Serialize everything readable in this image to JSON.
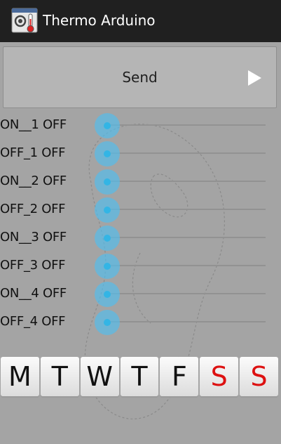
{
  "app": {
    "title": "Thermo Arduino",
    "icon": "thermometer-window-icon"
  },
  "send_button": {
    "label": "Send",
    "icon": "play-arrow-icon"
  },
  "switch_rows": [
    {
      "label": "ON__1 OFF"
    },
    {
      "label": "OFF_1 OFF"
    },
    {
      "label": "ON__2 OFF"
    },
    {
      "label": "OFF_2 OFF"
    },
    {
      "label": "ON__3 OFF"
    },
    {
      "label": "OFF_3 OFF"
    },
    {
      "label": "ON__4 OFF"
    },
    {
      "label": "OFF_4 OFF"
    }
  ],
  "weekdays": [
    {
      "label": "M",
      "color": "#111111"
    },
    {
      "label": "T",
      "color": "#111111"
    },
    {
      "label": "W",
      "color": "#111111"
    },
    {
      "label": "T",
      "color": "#111111"
    },
    {
      "label": "F",
      "color": "#111111"
    },
    {
      "label": "S",
      "color": "#dd1111"
    },
    {
      "label": "S",
      "color": "#dd1111"
    }
  ],
  "colors": {
    "accent": "#33b5e5",
    "actionbar": "#202020",
    "background": "#a4a4a4",
    "weekend": "#dd1111"
  }
}
